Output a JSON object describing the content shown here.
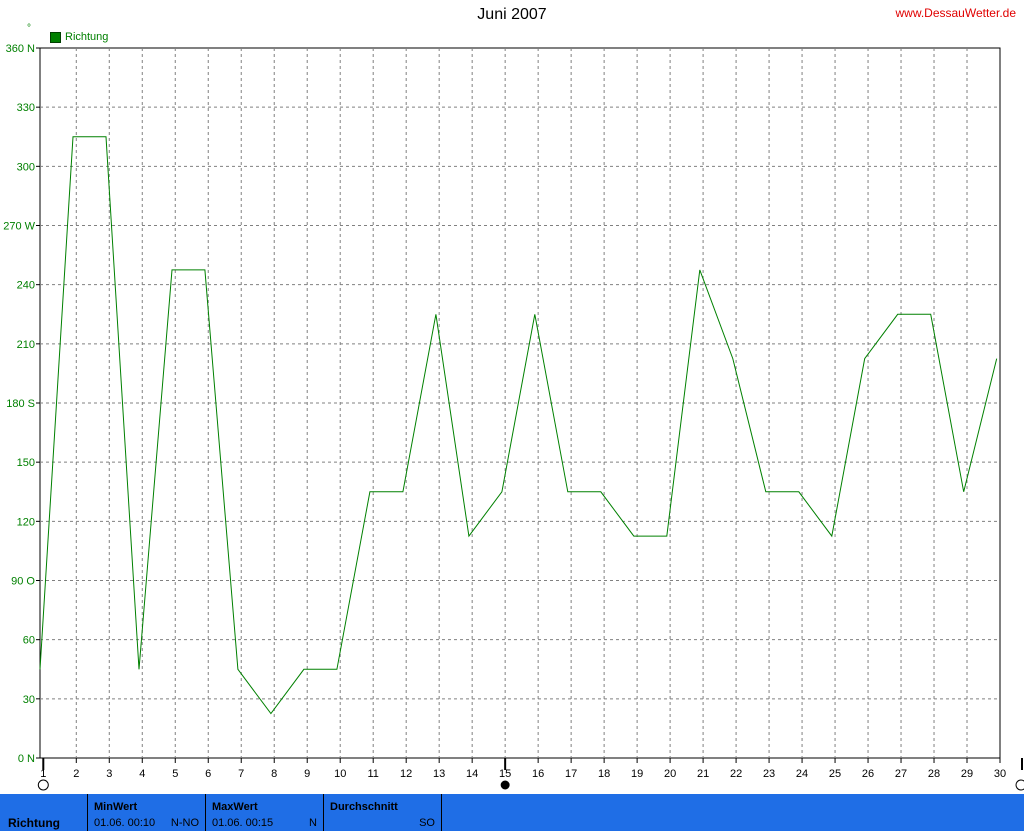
{
  "header": {
    "title": "Juni 2007",
    "site": "www.DessauWetter.de",
    "degree_symbol": "°"
  },
  "legend": {
    "label": "Richtung",
    "color": "#008000"
  },
  "chart_data": {
    "type": "line",
    "title": "Juni 2007",
    "x_ticks": [
      "1",
      "2",
      "3",
      "4",
      "5",
      "6",
      "7",
      "8",
      "9",
      "10",
      "11",
      "12",
      "13",
      "14",
      "15",
      "16",
      "17",
      "18",
      "19",
      "20",
      "21",
      "22",
      "23",
      "24",
      "25",
      "26",
      "27",
      "28",
      "29",
      "30"
    ],
    "y_ticks": [
      {
        "value": 0,
        "label": "0 N"
      },
      {
        "value": 30,
        "label": "30"
      },
      {
        "value": 60,
        "label": "60"
      },
      {
        "value": 90,
        "label": "90 O"
      },
      {
        "value": 120,
        "label": "120"
      },
      {
        "value": 150,
        "label": "150"
      },
      {
        "value": 180,
        "label": "180 S"
      },
      {
        "value": 210,
        "label": "210"
      },
      {
        "value": 240,
        "label": "240"
      },
      {
        "value": 270,
        "label": "270 W"
      },
      {
        "value": 300,
        "label": "300"
      },
      {
        "value": 330,
        "label": "330"
      },
      {
        "value": 360,
        "label": "360 N"
      }
    ],
    "ylim": [
      0,
      360
    ],
    "xlim": [
      0.9,
      30
    ],
    "grid": true,
    "legend_position": "top-left",
    "series": [
      {
        "name": "Richtung",
        "color": "#008000",
        "points": [
          [
            0.9,
            45
          ],
          [
            1.9,
            315
          ],
          [
            2.9,
            315
          ],
          [
            3.9,
            45
          ],
          [
            4.9,
            247.5
          ],
          [
            5.9,
            247.5
          ],
          [
            6.9,
            45
          ],
          [
            7.9,
            22.5
          ],
          [
            8.9,
            45
          ],
          [
            9.9,
            45
          ],
          [
            10.9,
            135
          ],
          [
            11.9,
            135
          ],
          [
            12.9,
            225
          ],
          [
            13.9,
            112.5
          ],
          [
            14.9,
            135
          ],
          [
            15.9,
            225
          ],
          [
            16.9,
            135
          ],
          [
            17.9,
            135
          ],
          [
            18.9,
            112.5
          ],
          [
            19.9,
            112.5
          ],
          [
            20.9,
            247.5
          ],
          [
            21.9,
            202.5
          ],
          [
            22.9,
            135
          ],
          [
            23.9,
            135
          ],
          [
            24.9,
            112.5
          ],
          [
            25.9,
            202.5
          ],
          [
            26.9,
            225
          ],
          [
            27.9,
            225
          ],
          [
            28.9,
            135
          ],
          [
            29.9,
            202.5
          ]
        ]
      }
    ]
  },
  "stats": {
    "row_label": "Richtung",
    "min": {
      "header": "MinWert",
      "time": "01.06.  00:10",
      "value": "N-NO"
    },
    "max": {
      "header": "MaxWert",
      "time": "01.06.  00:15",
      "value": "N"
    },
    "avg": {
      "header": "Durchschnitt",
      "value": "SO"
    }
  }
}
